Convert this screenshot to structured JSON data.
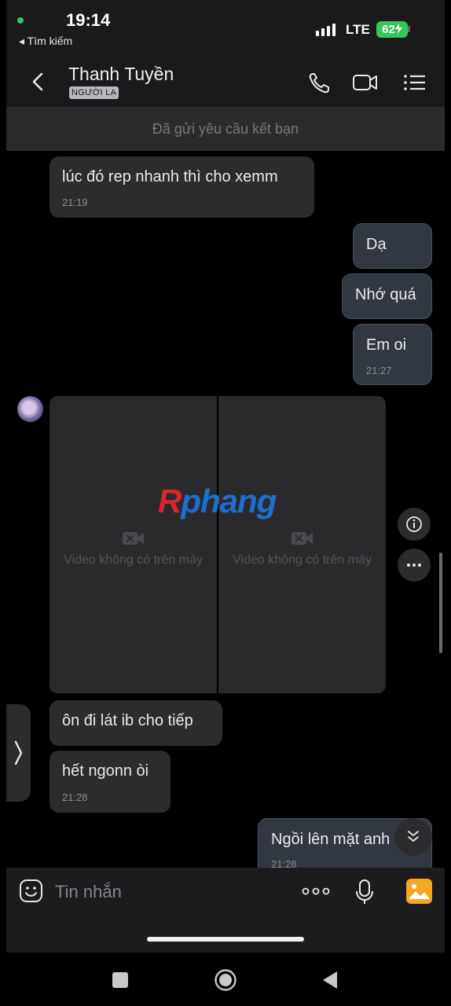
{
  "status_bar": {
    "time": "19:14",
    "back_label": "◂ Tìm kiếm",
    "network": "LTE",
    "battery": "62"
  },
  "header": {
    "contact_name": "Thanh Tuyền",
    "contact_badge": "NGƯỜI LẠ",
    "icons": [
      "back-arrow-icon",
      "phone-icon",
      "video-call-icon",
      "menu-icon"
    ]
  },
  "friend_request_banner": "Đã gửi yêu cầu kết bạn",
  "messages": [
    {
      "from": "them",
      "text": "lúc đó rep nhanh thì cho xemm",
      "time": "21:19"
    },
    {
      "from": "me",
      "text": "Dạ",
      "time": ""
    },
    {
      "from": "me",
      "text": "Nhớ quá",
      "time": ""
    },
    {
      "from": "me",
      "text": "Em oi",
      "time": "21:27"
    },
    {
      "from": "them",
      "text": "ôn đi lát ib cho tiếp",
      "time": ""
    },
    {
      "from": "them",
      "text": "hết ngonn òi",
      "time": "21:28"
    },
    {
      "from": "me",
      "text": "Ngồi lên mặt anh",
      "time": "21:28"
    }
  ],
  "videos": [
    {
      "caption": "Video không có trên máy"
    },
    {
      "caption": "Video không có trên máy"
    }
  ],
  "watermark": {
    "part1": "R",
    "part2": "phang"
  },
  "composer": {
    "placeholder": "Tin nhắn",
    "icons": [
      "emoji-icon",
      "more-dots-icon",
      "microphone-icon",
      "gallery-icon"
    ]
  },
  "colors": {
    "background": "#000000",
    "bubble_them": "#2c2c2f",
    "bubble_me": "#323841",
    "battery": "#34c759",
    "gallery_icon": "#f5a623"
  }
}
